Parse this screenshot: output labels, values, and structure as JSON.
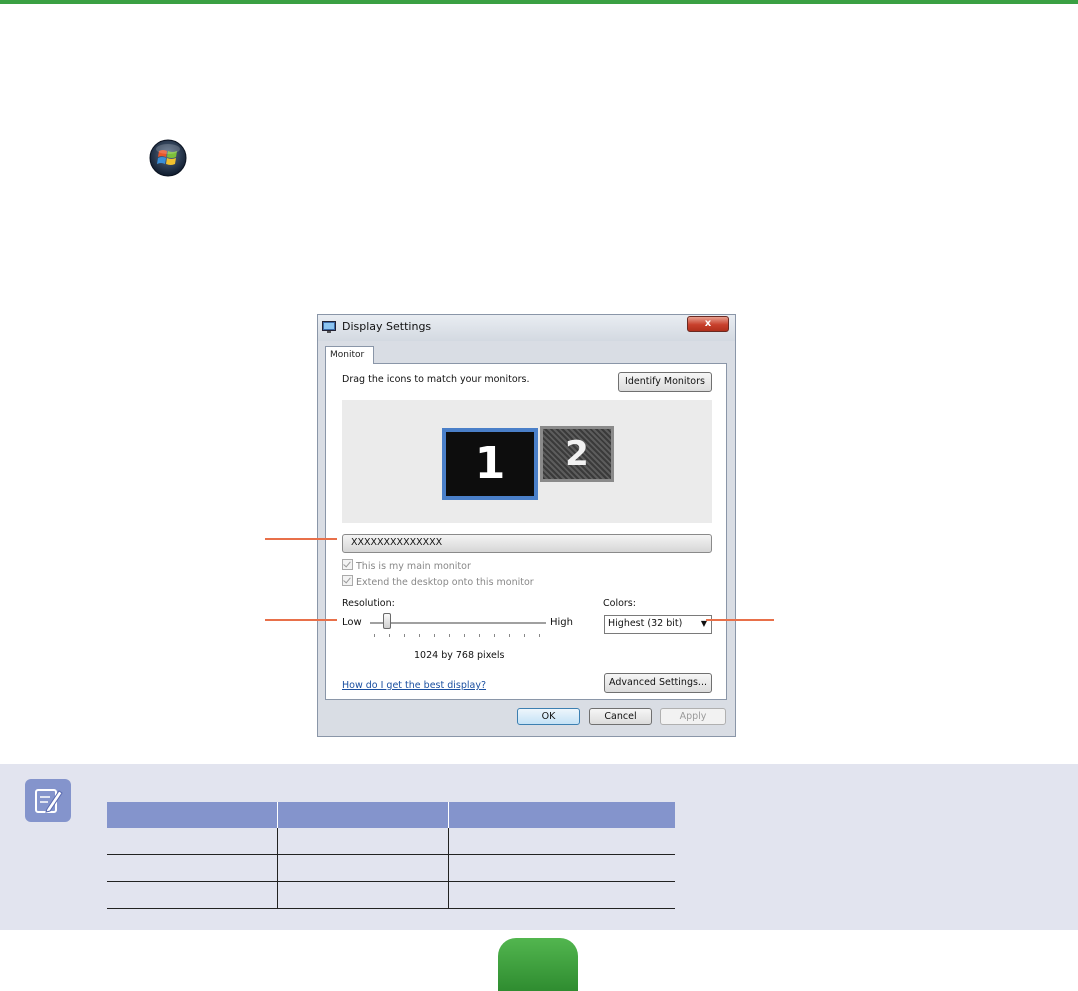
{
  "dialog": {
    "title": "Display Settings",
    "close_label": "x",
    "tab_label": "Monitor",
    "drag_instruction": "Drag the icons to match your monitors.",
    "identify_button": "Identify Monitors",
    "monitors": [
      "1",
      "2"
    ],
    "monitor_select_value": "XXXXXXXXXXXXXX",
    "checkbox_main_monitor": "This is my main monitor",
    "checkbox_extend_desktop": "Extend the desktop onto this monitor",
    "resolution_label": "Resolution:",
    "slider_low": "Low",
    "slider_high": "High",
    "resolution_value": "1024 by 768 pixels",
    "colors_label": "Colors:",
    "colors_value": "Highest (32 bit)",
    "help_link": "How do I get the best display?",
    "advanced_button": "Advanced Settings...",
    "ok_button": "OK",
    "cancel_button": "Cancel",
    "apply_button": "Apply"
  },
  "colors": {
    "top_bar": "#3aa043",
    "callout_line": "#e8704a",
    "note_background": "#e2e4ef",
    "table_header": "#8494cc",
    "page_tab": "#3fa13f"
  },
  "icons": [
    "windows-start-orb-icon",
    "display-settings-icon",
    "note-pencil-icon"
  ]
}
